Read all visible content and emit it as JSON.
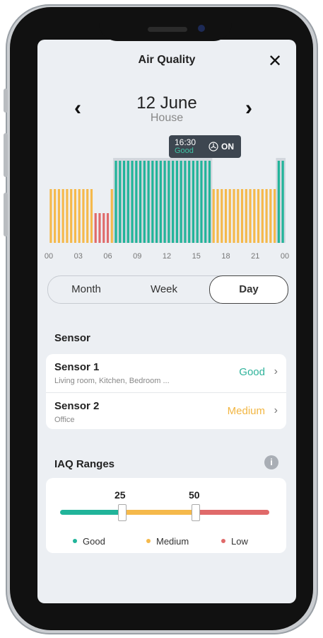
{
  "header": {
    "title": "Air Quality",
    "close": "✕",
    "prev": "‹",
    "next": "›"
  },
  "date_nav": {
    "date": "12 June",
    "location": "House"
  },
  "tooltip": {
    "time": "16:30",
    "status": "Good",
    "fan_icon": "fan-icon",
    "fan_state": "ON"
  },
  "chart_data": {
    "type": "bar",
    "x_tick_labels": [
      "00",
      "03",
      "06",
      "09",
      "12",
      "15",
      "18",
      "21",
      "00"
    ],
    "levels": [
      "medium",
      "medium",
      "medium",
      "medium",
      "medium",
      "medium",
      "medium",
      "medium",
      "medium",
      "medium",
      "medium",
      "low",
      "low",
      "low",
      "low",
      "medium",
      "good",
      "good",
      "good",
      "good",
      "good",
      "good",
      "good",
      "good",
      "good",
      "good",
      "good",
      "good",
      "good",
      "good",
      "good",
      "good",
      "good",
      "good",
      "good",
      "good",
      "good",
      "good",
      "good",
      "good",
      "medium",
      "medium",
      "medium",
      "medium",
      "medium",
      "medium",
      "medium",
      "medium",
      "medium",
      "medium",
      "medium",
      "medium",
      "medium",
      "medium",
      "medium",
      "medium",
      "good",
      "good"
    ],
    "colors": {
      "good": "#21b49a",
      "medium": "#f5b94b",
      "low": "#e06a6a",
      "highlight_bg": "#d2d7dd"
    }
  },
  "segment": {
    "month": "Month",
    "week": "Week",
    "day": "Day",
    "selected": "Day"
  },
  "sensors": {
    "section_title": "Sensor",
    "items": [
      {
        "name": "Sensor 1",
        "subtitle": "Living room, Kitchen, Bedroom ...",
        "status": "Good",
        "status_color": "#2fb39b"
      },
      {
        "name": "Sensor 2",
        "subtitle": "Office",
        "status": "Medium",
        "status_color": "#f2b642"
      }
    ],
    "chevron": "›"
  },
  "iaq": {
    "section_title": "IAQ Ranges",
    "info_icon": "i",
    "threshold_low": "25",
    "threshold_high": "50",
    "legend": {
      "good": "Good",
      "medium": "Medium",
      "low": "Low"
    }
  }
}
